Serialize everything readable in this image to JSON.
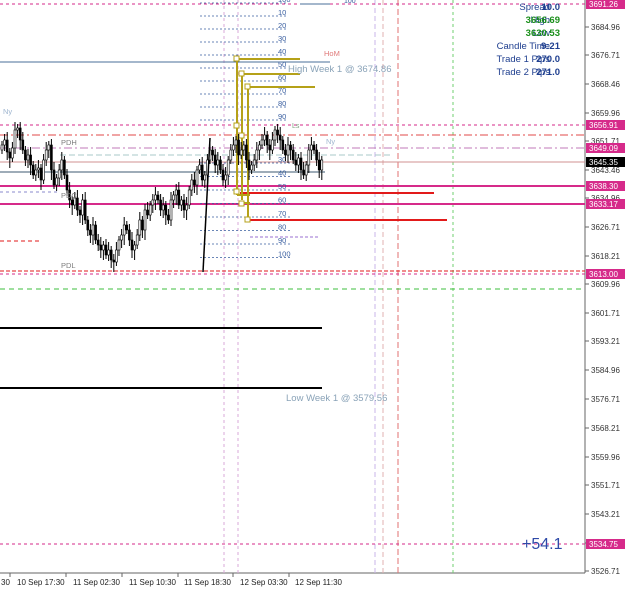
{
  "info_panel": {
    "items": [
      {
        "label": "Spread",
        "value": "10.0",
        "color": "#1f3f8f"
      },
      {
        "label": "High",
        "value": "3656.69",
        "color": "#1a8f1a"
      },
      {
        "label": "Low",
        "value": "3630.53",
        "color": "#1a8f1a"
      },
      {
        "label": "Candle Time",
        "value": "9:21",
        "color": "#1f3f8f"
      },
      {
        "label": "Trade 1 Pips",
        "value": "270.0",
        "color": "#1f3f8f"
      },
      {
        "label": "Trade 2 Pips",
        "value": "271.0",
        "color": "#1f3f8f"
      }
    ]
  },
  "price_axis": {
    "labels": [
      "3684.96",
      "3676.71",
      "3668.46",
      "3659.96",
      "3651.71",
      "3643.46",
      "3634.96",
      "3626.71",
      "3618.21",
      "3609.96",
      "3601.71",
      "3593.21",
      "3584.96",
      "3576.71",
      "3568.21",
      "3559.96",
      "3551.71",
      "3543.21",
      "3534.71",
      "3526.71"
    ],
    "badges": [
      {
        "text": "3691.26",
        "color": "#d62a8a"
      },
      {
        "text": "3656.91",
        "color": "#d62a8a"
      },
      {
        "text": "3649.09",
        "color": "#d62a8a"
      },
      {
        "text": "3645.35",
        "color": "#000000"
      },
      {
        "text": "3638.30",
        "color": "#d62a8a"
      },
      {
        "text": "3633.17",
        "color": "#d62a8a"
      },
      {
        "text": "3613.00",
        "color": "#d62a8a"
      },
      {
        "text": "3534.75",
        "color": "#d62a8a"
      }
    ]
  },
  "time_axis": {
    "labels": [
      "30",
      "10 Sep 17:30",
      "11 Sep 02:30",
      "11 Sep 10:30",
      "11 Sep 18:30",
      "12 Sep 03:30",
      "12 Sep 11:30"
    ]
  },
  "fib_top": {
    "levels": [
      "100",
      "10",
      "20",
      "30",
      "40",
      "50",
      "60",
      "70",
      "80",
      "90"
    ]
  },
  "fib_bottom": {
    "levels": [
      "30",
      "40",
      "50",
      "60",
      "70",
      "80",
      "90",
      "100"
    ]
  },
  "annotations": {
    "high_week": "High Week 1 @ 3674.86",
    "low_week": "Low Week 1 @ 3579.56",
    "hom": "HoM",
    "ny1": "Ny",
    "ny2": "Ny",
    "pdh": "PDH",
    "pdc": "PDC",
    "pdl": "PDL",
    "ls": "Ls",
    "top_fib_100": "100"
  },
  "profit_label": "+54.1",
  "colors": {
    "magenta": "#d62a8a",
    "red": "#e21a1a",
    "olive": "#b5a118",
    "green_dash": "#3cbf3c",
    "fib_blue": "#3a5fa0"
  }
}
